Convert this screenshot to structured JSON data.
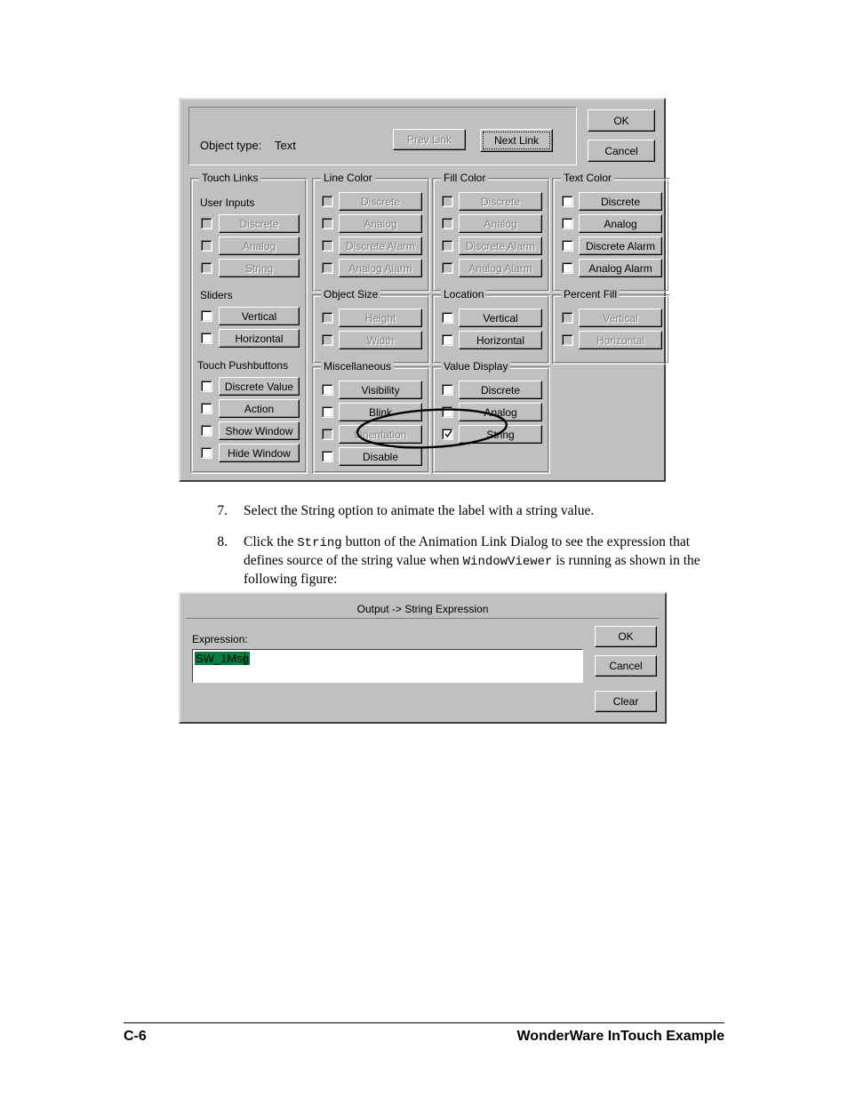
{
  "page": {
    "footer_left": "C-6",
    "footer_right": "WonderWare InTouch Example"
  },
  "animation_link_dialog": {
    "object_type_label": "Object type:",
    "object_type_value": "Text",
    "prev_link_label": "Prev Link",
    "next_link_label": "Next Link",
    "ok_label": "OK",
    "cancel_label": "Cancel",
    "groups": {
      "touch_links": {
        "title": "Touch Links",
        "captions": [
          "User Inputs",
          "Sliders",
          "Touch Pushbuttons"
        ],
        "user_inputs": [
          {
            "label": "Discrete",
            "checked": false,
            "enabled": false
          },
          {
            "label": "Analog",
            "checked": false,
            "enabled": false
          },
          {
            "label": "String",
            "checked": false,
            "enabled": false
          }
        ],
        "sliders": [
          {
            "label": "Vertical",
            "checked": false,
            "enabled": true
          },
          {
            "label": "Horizontal",
            "checked": false,
            "enabled": true
          }
        ],
        "touch_pushbuttons": [
          {
            "label": "Discrete Value",
            "checked": false,
            "enabled": true
          },
          {
            "label": "Action",
            "checked": false,
            "enabled": true
          },
          {
            "label": "Show Window",
            "checked": false,
            "enabled": true
          },
          {
            "label": "Hide Window",
            "checked": false,
            "enabled": true
          }
        ]
      },
      "line_color": {
        "title": "Line Color",
        "items": [
          {
            "label": "Discrete",
            "checked": false,
            "enabled": false
          },
          {
            "label": "Analog",
            "checked": false,
            "enabled": false
          },
          {
            "label": "Discrete Alarm",
            "checked": false,
            "enabled": false
          },
          {
            "label": "Analog Alarm",
            "checked": false,
            "enabled": false
          }
        ]
      },
      "fill_color": {
        "title": "Fill Color",
        "items": [
          {
            "label": "Discrete",
            "checked": false,
            "enabled": false
          },
          {
            "label": "Analog",
            "checked": false,
            "enabled": false
          },
          {
            "label": "Discrete Alarm",
            "checked": false,
            "enabled": false
          },
          {
            "label": "Analog Alarm",
            "checked": false,
            "enabled": false
          }
        ]
      },
      "text_color": {
        "title": "Text Color",
        "items": [
          {
            "label": "Discrete",
            "checked": false,
            "enabled": true
          },
          {
            "label": "Analog",
            "checked": false,
            "enabled": true
          },
          {
            "label": "Discrete Alarm",
            "checked": false,
            "enabled": true
          },
          {
            "label": "Analog Alarm",
            "checked": false,
            "enabled": true
          }
        ]
      },
      "object_size": {
        "title": "Object Size",
        "items": [
          {
            "label": "Height",
            "checked": false,
            "enabled": false
          },
          {
            "label": "Width",
            "checked": false,
            "enabled": false
          }
        ]
      },
      "location": {
        "title": "Location",
        "items": [
          {
            "label": "Vertical",
            "checked": false,
            "enabled": true
          },
          {
            "label": "Horizontal",
            "checked": false,
            "enabled": true
          }
        ]
      },
      "percent_fill": {
        "title": "Percent Fill",
        "items": [
          {
            "label": "Vertical",
            "checked": false,
            "enabled": false
          },
          {
            "label": "Horizontal",
            "checked": false,
            "enabled": false
          }
        ]
      },
      "miscellaneous": {
        "title": "Miscellaneous",
        "items": [
          {
            "label": "Visibility",
            "checked": false,
            "enabled": true
          },
          {
            "label": "Blink",
            "checked": false,
            "enabled": true
          },
          {
            "label": "Orientation",
            "checked": false,
            "enabled": false
          },
          {
            "label": "Disable",
            "checked": false,
            "enabled": true
          }
        ]
      },
      "value_display": {
        "title": "Value Display",
        "items": [
          {
            "label": "Discrete",
            "checked": false,
            "enabled": true
          },
          {
            "label": "Analog",
            "checked": false,
            "enabled": true
          },
          {
            "label": "String",
            "checked": true,
            "enabled": true
          }
        ]
      }
    }
  },
  "steps": [
    {
      "number": "7.",
      "parts": [
        {
          "t": "Select the String option to animate the label with a string value.",
          "mono": false
        }
      ]
    },
    {
      "number": "8.",
      "parts": [
        {
          "t": "Click the ",
          "mono": false
        },
        {
          "t": "String",
          "mono": true
        },
        {
          "t": " button of the Animation Link Dialog to see the expression that defines source of  the string value when ",
          "mono": false
        },
        {
          "t": "WindowViewer",
          "mono": true
        },
        {
          "t": " is running as shown in the following figure:",
          "mono": false
        }
      ]
    }
  ],
  "string_expression_dialog": {
    "title": "Output -> String Expression",
    "expression_label": "Expression:",
    "expression_value": "SW_1Msg",
    "selection_color": "#008040",
    "ok_label": "OK",
    "cancel_label": "Cancel",
    "clear_label": "Clear"
  }
}
